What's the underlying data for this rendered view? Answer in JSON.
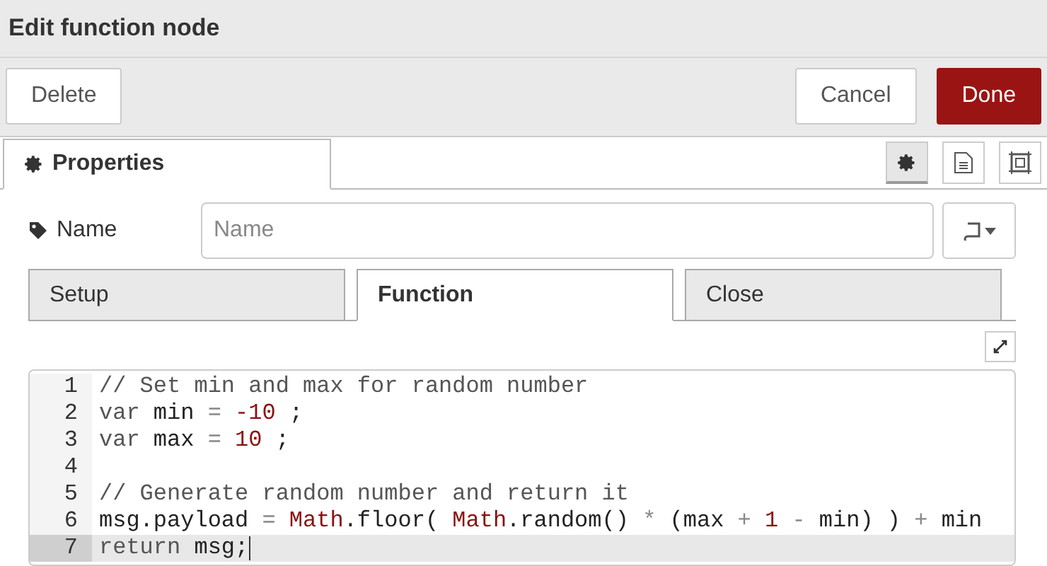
{
  "window": {
    "title": "Edit function node"
  },
  "toolbar": {
    "buttons": [
      {
        "label": "Delete",
        "kind": "plain"
      },
      {
        "label": "Cancel",
        "kind": "plain"
      },
      {
        "label": "Done",
        "kind": "primary"
      }
    ]
  },
  "panel_tabs": [
    {
      "label": "Properties",
      "selected": true
    }
  ],
  "panel_icons": [
    {
      "kind": "gear",
      "selected": true
    },
    {
      "kind": "document",
      "selected": false
    },
    {
      "kind": "frame",
      "selected": false
    }
  ],
  "name_field": {
    "label": "Name",
    "placeholder": "Name"
  },
  "tabs": [
    {
      "label": "Setup",
      "selected": false
    },
    {
      "label": "Function",
      "selected": true
    },
    {
      "label": "Close",
      "selected": false
    }
  ],
  "editor": {
    "lines": [
      {
        "number": "1",
        "selected": false,
        "tokens": [
          {
            "kind": "comment",
            "text": "// Set min and max for random number"
          }
        ]
      },
      {
        "number": "2",
        "selected": false,
        "tokens": [
          {
            "kind": "keyword",
            "text": "var"
          },
          {
            "kind": "plain",
            "text": " min "
          },
          {
            "kind": "operator",
            "text": "= "
          },
          {
            "kind": "number",
            "text": "-10"
          },
          {
            "kind": "plain",
            "text": " ;"
          }
        ]
      },
      {
        "number": "3",
        "selected": false,
        "tokens": [
          {
            "kind": "keyword",
            "text": "var"
          },
          {
            "kind": "plain",
            "text": " max "
          },
          {
            "kind": "operator",
            "text": "= "
          },
          {
            "kind": "number",
            "text": "10"
          },
          {
            "kind": "plain",
            "text": " ;"
          }
        ]
      },
      {
        "number": "4",
        "selected": false
      },
      {
        "number": "5",
        "selected": false,
        "tokens": [
          {
            "kind": "comment",
            "text": "// Generate random number and return it"
          }
        ]
      },
      {
        "number": "6",
        "selected": false,
        "tokens": [
          {
            "kind": "plain",
            "text": "msg.payload "
          },
          {
            "kind": "operator",
            "text": "= "
          },
          {
            "kind": "builtin",
            "text": "Math"
          },
          {
            "kind": "plain",
            "text": ".floor( "
          },
          {
            "kind": "builtin",
            "text": "Math"
          },
          {
            "kind": "plain",
            "text": ".random() "
          },
          {
            "kind": "operator",
            "text": "*"
          },
          {
            "kind": "plain",
            "text": " (max "
          },
          {
            "kind": "operator",
            "text": "+ "
          },
          {
            "kind": "number",
            "text": "1"
          },
          {
            "kind": "operator",
            "text": " -"
          },
          {
            "kind": "plain",
            "text": " min) ) "
          },
          {
            "kind": "operator",
            "text": "+"
          },
          {
            "kind": "plain",
            "text": " min"
          }
        ]
      },
      {
        "number": "7",
        "selected": true,
        "tokens": [
          {
            "kind": "keyword",
            "text": "return"
          },
          {
            "kind": "plain",
            "text": " msg;"
          }
        ]
      }
    ]
  }
}
